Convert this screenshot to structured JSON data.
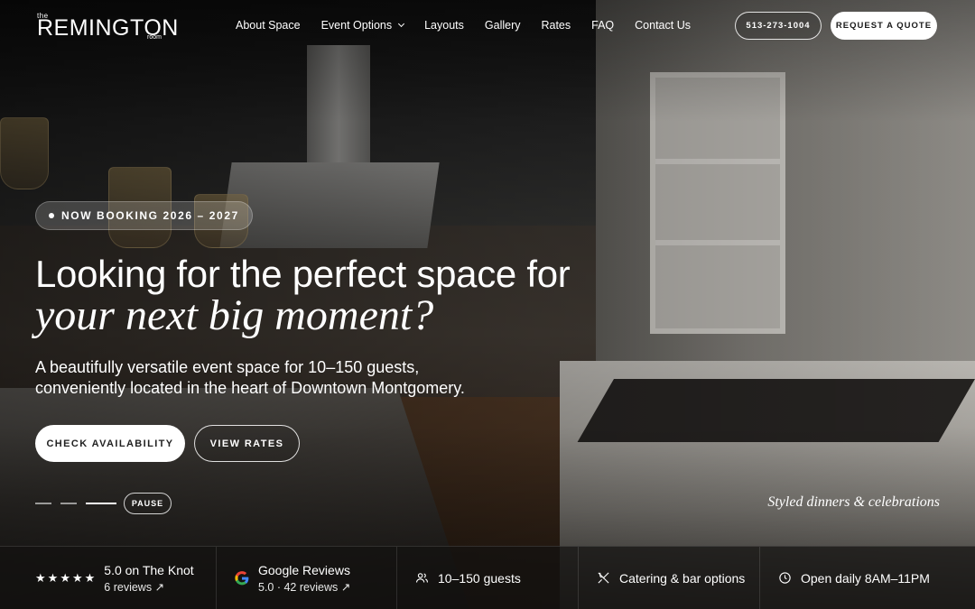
{
  "header": {
    "logo_the": "the",
    "logo_main": "REMINGTON",
    "logo_room": "room",
    "nav": [
      "About Space",
      "Event Options",
      "Layouts",
      "Gallery",
      "Rates",
      "FAQ",
      "Contact Us"
    ],
    "phone": "513-273-1004",
    "quote": "REQUEST A QUOTE"
  },
  "hero": {
    "badge": "NOW BOOKING 2026 – 2027",
    "headline": "Looking for the perfect space for",
    "headline_italic": "your next big moment?",
    "subtext": "A beautifully versatile event space for 10–150 guests, conveniently located in the heart of Downtown Montgomery.",
    "primary_button": "CHECK AVAILABILITY",
    "secondary_button": "VIEW RATES",
    "pause": "PAUSE",
    "caption": "Styled dinners & celebrations",
    "slides": {
      "count": 3,
      "active_index": 2
    }
  },
  "stats": {
    "knot_title": "5.0 on The Knot",
    "knot_sub": "6 reviews ↗",
    "google_title": "Google Reviews",
    "google_sub": "5.0 · 42 reviews ↗",
    "guests": "10–150 guests",
    "catering": "Catering & bar options",
    "hours": "Open daily 8AM–11PM",
    "star_count": 5
  },
  "colors": {
    "overlay": "#141210",
    "button_fill": "#ffffff",
    "google_blue": "#4285F4",
    "google_red": "#EA4335",
    "google_yellow": "#FBBC05",
    "google_green": "#34A853"
  },
  "icons": [
    "chevron-down-icon",
    "star-icon",
    "google-icon",
    "users-icon",
    "utensils-icon",
    "clock-icon",
    "external-link-icon"
  ]
}
